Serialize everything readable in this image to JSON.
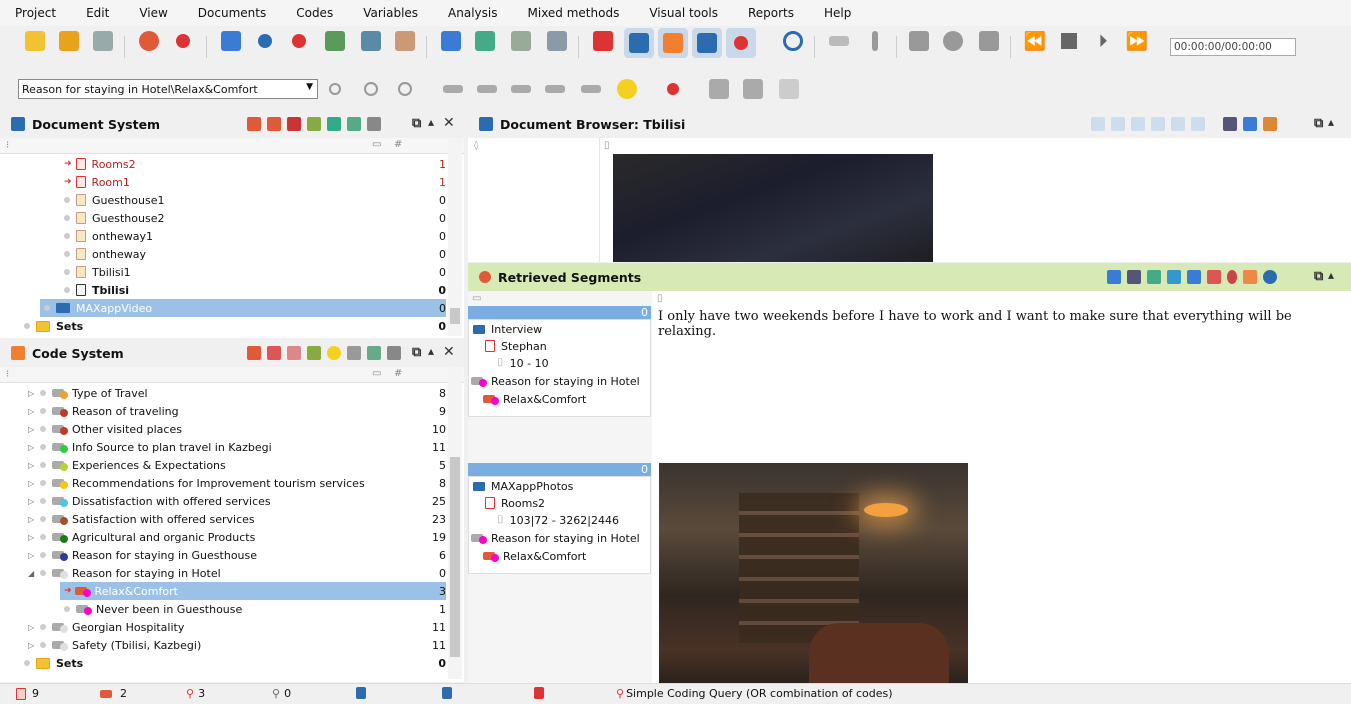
{
  "menu": [
    "Project",
    "Edit",
    "View",
    "Documents",
    "Codes",
    "Variables",
    "Analysis",
    "Mixed methods",
    "Visual tools",
    "Reports",
    "Help"
  ],
  "toolbar": {
    "timer": "00:00:00/00:00:00",
    "code_select": "Reason for staying in Hotel\\Relax&Comfort"
  },
  "doc_system": {
    "title": "Document System",
    "rows": [
      {
        "label": "Rooms2",
        "count": "1",
        "kind": "photo",
        "red": true
      },
      {
        "label": "Room1",
        "count": "1",
        "kind": "photo",
        "red": true
      },
      {
        "label": "Guesthouse1",
        "count": "0",
        "kind": "photo"
      },
      {
        "label": "Guesthouse2",
        "count": "0",
        "kind": "photo"
      },
      {
        "label": "ontheway1",
        "count": "0",
        "kind": "photo"
      },
      {
        "label": "ontheway",
        "count": "0",
        "kind": "photo"
      },
      {
        "label": "Tbilisi1",
        "count": "0",
        "kind": "photo"
      },
      {
        "label": "Tbilisi",
        "count": "0",
        "kind": "doc",
        "bold": true
      },
      {
        "label": "MAXappVideo",
        "count": "0",
        "kind": "folder",
        "selected": true
      },
      {
        "label": "Sets",
        "count": "0",
        "kind": "sets",
        "bold": true
      }
    ]
  },
  "code_system": {
    "title": "Code System",
    "rows": [
      {
        "label": "Type of Travel",
        "count": "8",
        "color": "#f0a030"
      },
      {
        "label": "Reason of traveling",
        "count": "9",
        "color": "#c0392b"
      },
      {
        "label": "Other visited places",
        "count": "10",
        "color": "#c0392b"
      },
      {
        "label": "Info Source to plan travel in Kazbegi",
        "count": "11",
        "color": "#2ecc40"
      },
      {
        "label": "Experiences & Expectations",
        "count": "5",
        "color": "#b5d335"
      },
      {
        "label": "Recommendations for Improvement tourism services",
        "count": "8",
        "color": "#f5c518"
      },
      {
        "label": "Dissatisfaction with offered services",
        "count": "25",
        "color": "#4fc3e8"
      },
      {
        "label": "Satisfaction with offered services",
        "count": "23",
        "color": "#a0522d"
      },
      {
        "label": "Agricultural and organic Products",
        "count": "19",
        "color": "#1a7a1a"
      },
      {
        "label": "Reason for staying in Guesthouse",
        "count": "6",
        "color": "#2c3e91"
      },
      {
        "label": "Reason for staying in Hotel",
        "count": "0",
        "color": "#e0e0e0",
        "expanded": true
      },
      {
        "label": "Relax&Comfort",
        "count": "3",
        "color": "#ff00cc",
        "child": true,
        "selected": true,
        "red": true
      },
      {
        "label": "Never been in Guesthouse",
        "count": "1",
        "color": "#ff00cc",
        "child": true
      },
      {
        "label": "Georgian Hospitality",
        "count": "11",
        "color": "#e0e0e0"
      },
      {
        "label": "Safety (Tbilisi, Kazbegi)",
        "count": "11",
        "color": "#e0e0e0"
      },
      {
        "label": "Sets",
        "count": "0",
        "color": "",
        "sets": true
      }
    ]
  },
  "doc_browser": {
    "title": "Document Browser: Tbilisi"
  },
  "retrieved": {
    "title": "Retrieved Segments",
    "seg1": {
      "count": "0",
      "group": "Interview",
      "doc": "Stephan",
      "pos": "10 - 10",
      "code_parent": "Reason for staying in Hotel",
      "code": "Relax&Comfort",
      "text": "I only have two weekends before I have to work and I want to make sure that everything will be relaxing."
    },
    "seg2": {
      "count": "0",
      "group": "MAXappPhotos",
      "doc": "Rooms2",
      "pos": "103|72 - 3262|2446",
      "code_parent": "Reason for staying in Hotel",
      "code": "Relax&Comfort"
    }
  },
  "status": {
    "docs": "9",
    "codes": "2",
    "segs": "3",
    "vars": "0",
    "query": "Simple Coding Query (OR combination of codes)"
  }
}
